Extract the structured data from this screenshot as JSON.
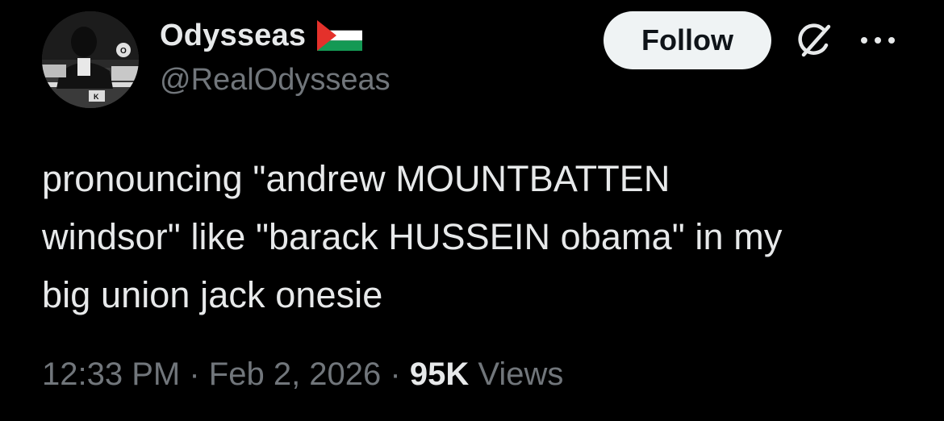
{
  "author": {
    "display_name": "Odysseas",
    "handle": "@RealOdysseas",
    "flag_icon": "palestine-flag-icon"
  },
  "actions": {
    "follow_label": "Follow",
    "grok_icon": "grok-icon",
    "more_icon": "more-horizontal-icon"
  },
  "tweet": {
    "lines": [
      "pronouncing \"andrew MOUNTBATTEN",
      "windsor\" like \"barack HUSSEIN obama\" in my",
      "big union jack onesie"
    ]
  },
  "meta": {
    "time": "12:33 PM",
    "separator": "·",
    "date": "Feb 2, 2026",
    "views_count": "95K",
    "views_label": "Views"
  },
  "colors": {
    "background": "#000000",
    "primary_text": "#e7e9ea",
    "secondary_text": "#71767b",
    "follow_bg": "#eff3f4",
    "follow_text": "#0f1419"
  }
}
